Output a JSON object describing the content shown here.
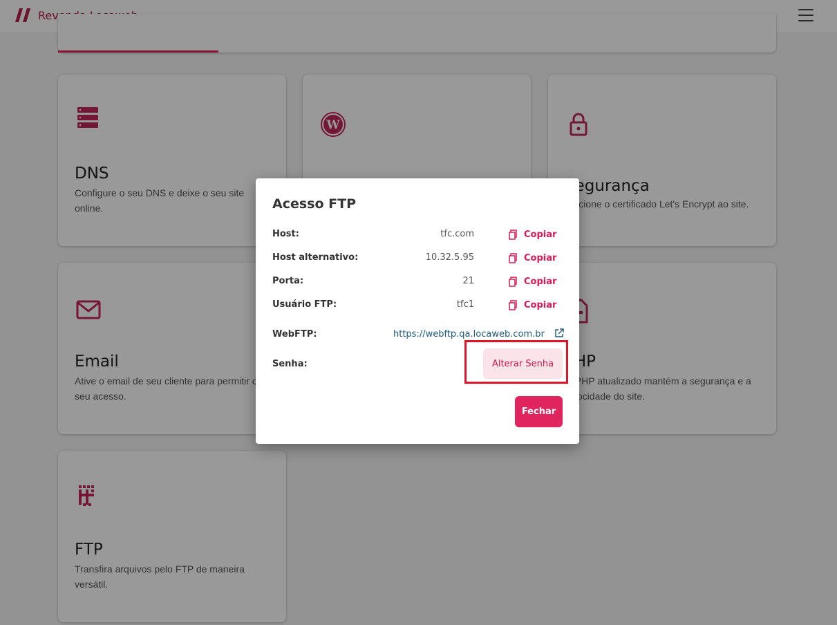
{
  "header": {
    "brand": "Revenda Locaweb",
    "logo_icon": "locaweb-slash-logo",
    "menu_icon": "hamburger-menu-icon"
  },
  "tabs": [
    ""
  ],
  "cards": [
    {
      "id": "dns",
      "icon": "server-icon",
      "title": "DNS",
      "description": "Configure o seu DNS e deixe o seu site online."
    },
    {
      "id": "wordpress",
      "icon": "wordpress-icon",
      "title": "",
      "description": ""
    },
    {
      "id": "seguranca",
      "icon": "lock-icon",
      "title": "Segurança",
      "description": "Adicione o certificado Let's Encrypt ao site."
    },
    {
      "id": "email",
      "icon": "envelope-icon",
      "title": "Email",
      "description": "Ative o email de seu cliente para permitir o seu acesso."
    },
    {
      "id": "php",
      "icon": "php-file-icon",
      "title": "PHP",
      "description": "O PHP atualizado mantém a segurança e a velocidade do site."
    },
    {
      "id": "ftp",
      "icon": "ftp-icon",
      "title": "FTP",
      "description": "Transfira arquivos pelo FTP de maneira versátil."
    }
  ],
  "modal": {
    "title": "Acesso FTP",
    "copy_label": "Copiar",
    "rows": [
      {
        "label": "Host:",
        "value": "tfc.com"
      },
      {
        "label": "Host alternativo:",
        "value": "10.32.5.95"
      },
      {
        "label": "Porta:",
        "value": "21"
      },
      {
        "label": "Usuário FTP:",
        "value": "tfc1"
      }
    ],
    "webftp_label": "WebFTP:",
    "webftp_url": "https://webftp.qa.locaweb.com.br",
    "senha_label": "Senha:",
    "alterar_label": "Alterar Senha",
    "fechar_label": "Fechar"
  },
  "colors": {
    "accent": "#e0245e",
    "brand": "#b41f4a",
    "highlight": "#e0142a",
    "link": "#1f5a7a"
  }
}
